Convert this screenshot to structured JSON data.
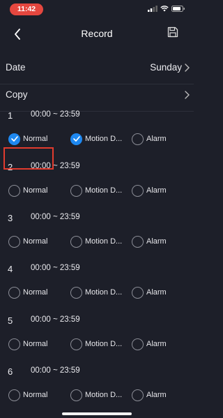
{
  "status_bar": {
    "time": "11:42"
  },
  "header": {
    "title": "Record"
  },
  "settings": [
    {
      "label": "Date",
      "value": "Sunday"
    },
    {
      "label": "Copy",
      "value": ""
    }
  ],
  "slots": [
    {
      "index": "1",
      "time": "00:00 ~ 23:59",
      "normal": "Normal",
      "motion": "Motion D...",
      "alarm": "Alarm",
      "normal_checked": true,
      "motion_checked": true,
      "alarm_checked": false
    },
    {
      "index": "2",
      "time": "00:00 ~ 23:59",
      "normal": "Normal",
      "motion": "Motion D...",
      "alarm": "Alarm",
      "normal_checked": false,
      "motion_checked": false,
      "alarm_checked": false
    },
    {
      "index": "3",
      "time": "00:00 ~ 23:59",
      "normal": "Normal",
      "motion": "Motion D...",
      "alarm": "Alarm",
      "normal_checked": false,
      "motion_checked": false,
      "alarm_checked": false
    },
    {
      "index": "4",
      "time": "00:00 ~ 23:59",
      "normal": "Normal",
      "motion": "Motion D...",
      "alarm": "Alarm",
      "normal_checked": false,
      "motion_checked": false,
      "alarm_checked": false
    },
    {
      "index": "5",
      "time": "00:00 ~ 23:59",
      "normal": "Normal",
      "motion": "Motion D...",
      "alarm": "Alarm",
      "normal_checked": false,
      "motion_checked": false,
      "alarm_checked": false
    },
    {
      "index": "6",
      "time": "00:00 ~ 23:59",
      "normal": "Normal",
      "motion": "Motion D...",
      "alarm": "Alarm",
      "normal_checked": false,
      "motion_checked": false,
      "alarm_checked": false
    }
  ],
  "colors": {
    "background": "#1d1f29",
    "accent": "#1e88f0",
    "highlight": "#e23b2e",
    "time_pill": "#e5473f"
  },
  "icons": {
    "back": "chevron-left-icon",
    "save": "floppy-disk-icon",
    "row_arrow": "chevron-right-icon"
  }
}
